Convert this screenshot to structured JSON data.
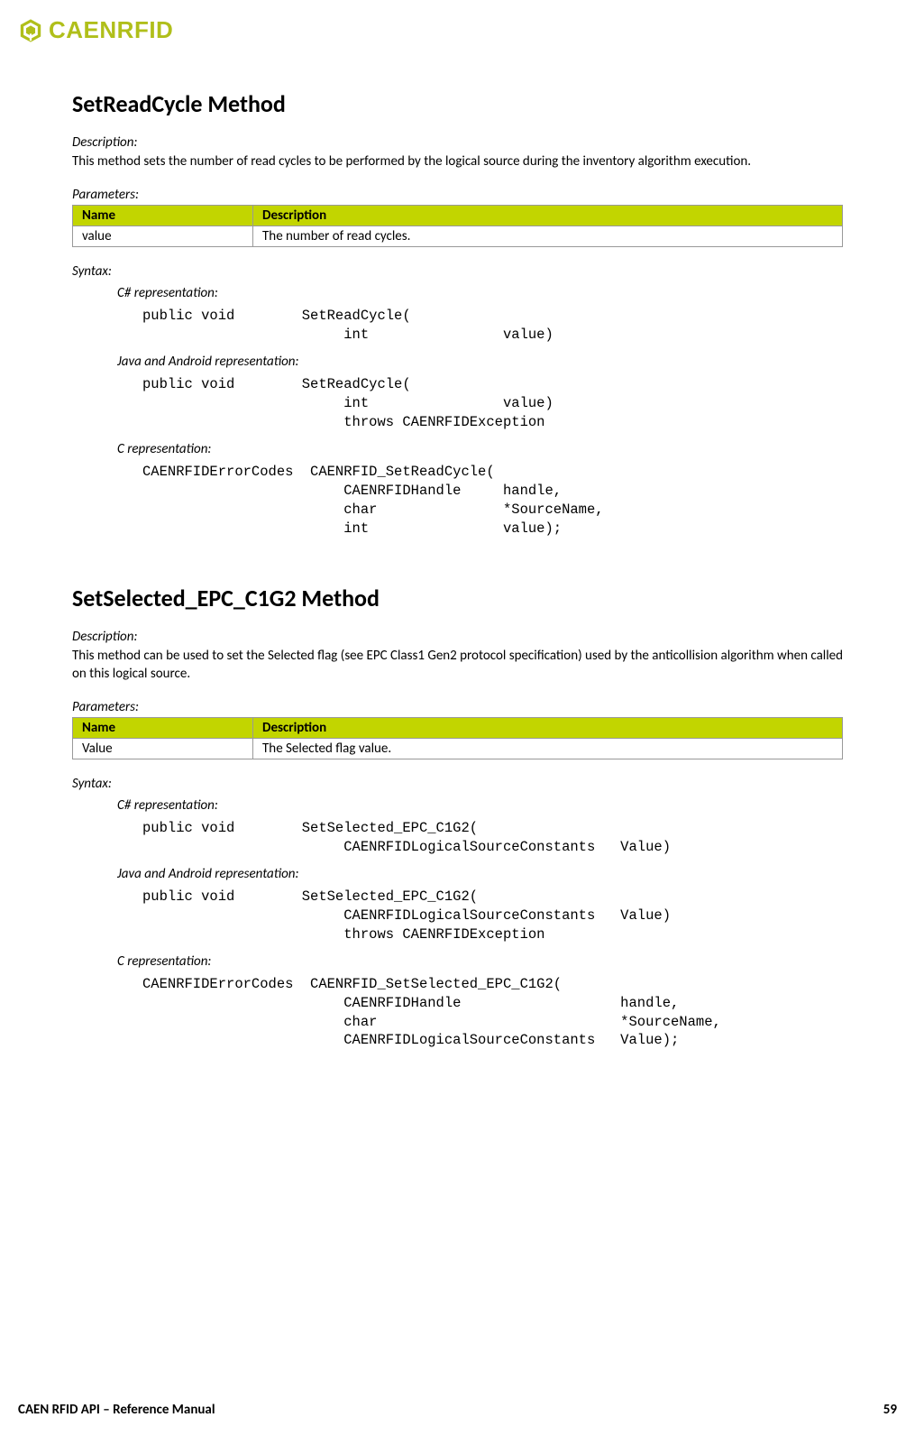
{
  "logo_text": "CAENRFID",
  "method1": {
    "title": "SetReadCycle Method",
    "desc_label": "Description:",
    "desc_text": "This method sets the number of read cycles to be performed by the logical source during the inventory algorithm execution.",
    "params_label": "Parameters:",
    "params_header_name": "Name",
    "params_header_desc": "Description",
    "params_row_name": "value",
    "params_row_desc": "The number of read cycles.",
    "syntax_label": "Syntax:",
    "csharp_label": "C# representation:",
    "csharp_code": "public void        SetReadCycle(\n                        int                value)",
    "java_label": "Java and Android representation:",
    "java_code": "public void        SetReadCycle(\n                        int                value)\n                        throws CAENRFIDException",
    "c_label": "C representation:",
    "c_code": "CAENRFIDErrorCodes  CAENRFID_SetReadCycle(\n                        CAENRFIDHandle     handle,\n                        char               *SourceName,\n                        int                value);"
  },
  "method2": {
    "title": "SetSelected_EPC_C1G2 Method",
    "desc_label": "Description:",
    "desc_text": "This method can be used to set the Selected flag (see EPC Class1 Gen2 protocol specification) used by the anticollision algorithm when called on this logical source.",
    "params_label": "Parameters:",
    "params_header_name": "Name",
    "params_header_desc": "Description",
    "params_row_name": "Value",
    "params_row_desc": "The Selected flag value.",
    "syntax_label": "Syntax:",
    "csharp_label": "C# representation:",
    "csharp_code": "public void        SetSelected_EPC_C1G2(\n                        CAENRFIDLogicalSourceConstants   Value)",
    "java_label": "Java and Android representation:",
    "java_code": "public void        SetSelected_EPC_C1G2(\n                        CAENRFIDLogicalSourceConstants   Value)\n                        throws CAENRFIDException",
    "c_label": "C representation:",
    "c_code": "CAENRFIDErrorCodes  CAENRFID_SetSelected_EPC_C1G2(\n                        CAENRFIDHandle                   handle,\n                        char                             *SourceName,\n                        CAENRFIDLogicalSourceConstants   Value);"
  },
  "footer_left": "CAEN RFID API – Reference Manual",
  "footer_right": "59"
}
